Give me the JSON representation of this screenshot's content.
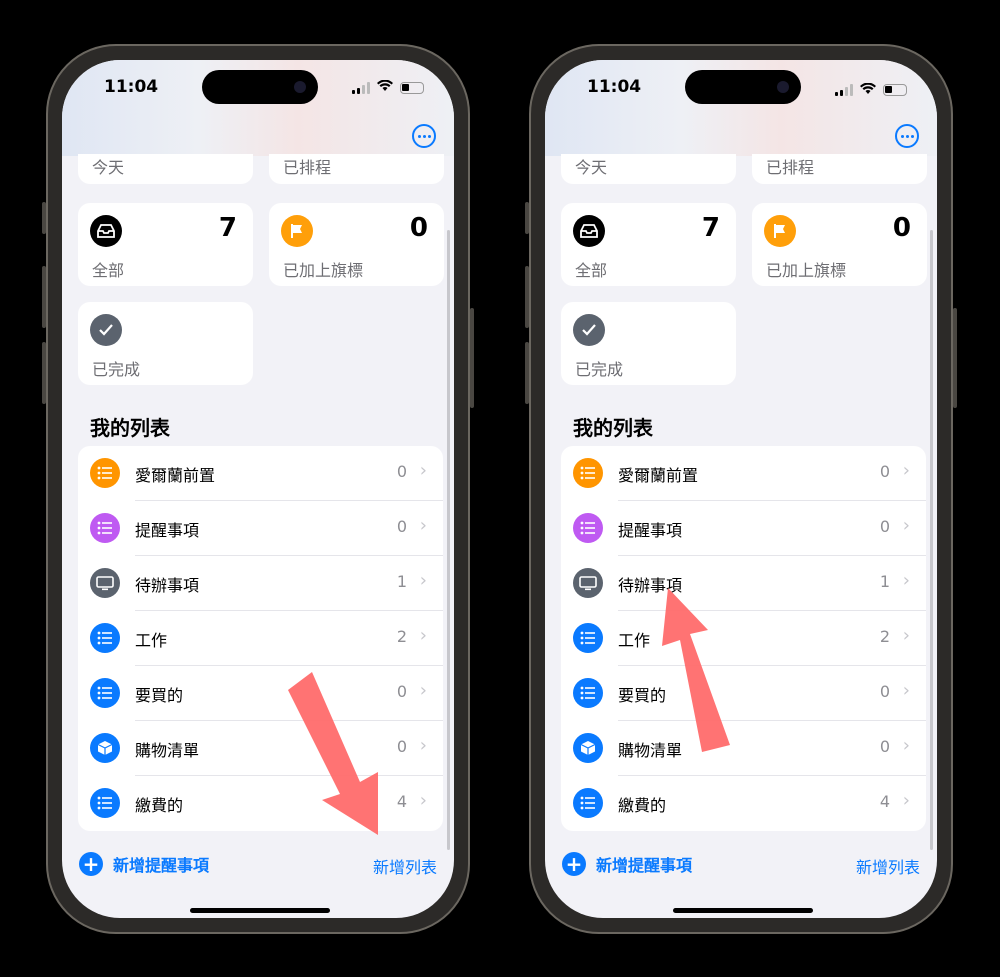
{
  "status": {
    "time": "11:04"
  },
  "smart_lists": {
    "today": {
      "label": "今天"
    },
    "scheduled": {
      "label": "已排程"
    },
    "all": {
      "label": "全部",
      "count": "7"
    },
    "flagged": {
      "label": "已加上旗標",
      "count": "0"
    },
    "completed": {
      "label": "已完成"
    }
  },
  "my_lists": {
    "title": "我的列表",
    "items": [
      {
        "name": "愛爾蘭前置",
        "count": "0",
        "color": "#ff9500",
        "icon": "list-icon"
      },
      {
        "name": "提醒事項",
        "count": "0",
        "color": "#bf5af2",
        "icon": "list-icon"
      },
      {
        "name": "待辦事項",
        "count": "1",
        "color": "#5b636e",
        "icon": "monitor-icon"
      },
      {
        "name": "工作",
        "count": "2",
        "color": "#0a7aff",
        "icon": "list-icon"
      },
      {
        "name": "要買的",
        "count": "0",
        "color": "#0a7aff",
        "icon": "list-icon"
      },
      {
        "name": "購物清單",
        "count": "0",
        "color": "#0a7aff",
        "icon": "box-icon"
      },
      {
        "name": "繳費的",
        "count": "4",
        "color": "#0a7aff",
        "icon": "list-icon"
      }
    ]
  },
  "toolbar": {
    "new_reminder": "新增提醒事項",
    "add_list": "新增列表"
  },
  "colors": {
    "accent": "#0a7aff",
    "arrow": "#ff6b6b",
    "flag": "#ff9f0a",
    "completed": "#5b636e"
  }
}
